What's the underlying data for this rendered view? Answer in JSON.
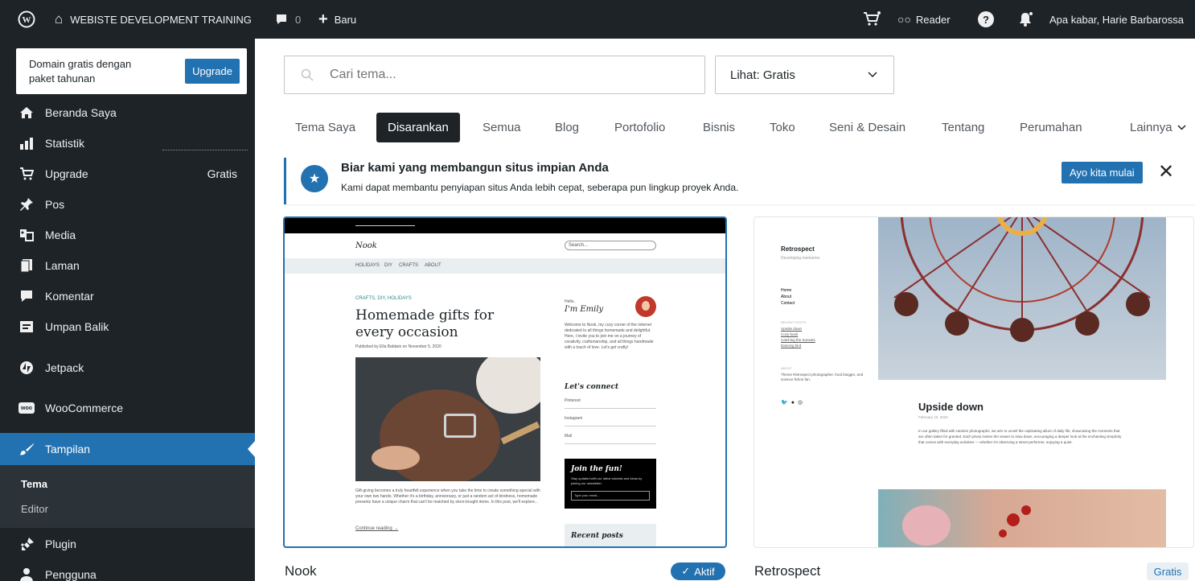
{
  "topbar": {
    "site_name": "WEBISTE DEVELOPMENT TRAINING",
    "comments_count": "0",
    "new_label": "Baru",
    "reader_label": "Reader",
    "greeting": "Apa kabar, Harie Barbarossa"
  },
  "sidebar": {
    "promo_text": "Domain gratis dengan paket tahunan",
    "promo_button": "Upgrade",
    "items": [
      {
        "label": "Beranda Saya",
        "icon": "home-icon"
      },
      {
        "label": "Statistik",
        "icon": "stats-icon"
      },
      {
        "label": "Upgrade",
        "icon": "cart-icon",
        "badge": "Gratis"
      },
      {
        "label": "Pos",
        "icon": "pin-icon"
      },
      {
        "label": "Media",
        "icon": "media-icon"
      },
      {
        "label": "Laman",
        "icon": "page-icon"
      },
      {
        "label": "Komentar",
        "icon": "comment-icon"
      },
      {
        "label": "Umpan Balik",
        "icon": "feedback-icon"
      },
      {
        "label": "Jetpack",
        "icon": "jetpack-icon"
      },
      {
        "label": "WooCommerce",
        "icon": "woo-icon"
      },
      {
        "label": "Tampilan",
        "icon": "brush-icon"
      },
      {
        "label": "Plugin",
        "icon": "plugin-icon"
      },
      {
        "label": "Pengguna",
        "icon": "user-icon"
      }
    ],
    "submenu": {
      "tema": "Tema",
      "editor": "Editor"
    }
  },
  "search": {
    "placeholder": "Cari tema..."
  },
  "filter": {
    "selected": "Lihat: Gratis"
  },
  "tabs": [
    "Tema Saya",
    "Disarankan",
    "Semua",
    "Blog",
    "Portofolio",
    "Bisnis",
    "Toko",
    "Seni & Desain",
    "Tentang",
    "Perumahan",
    "Lainnya"
  ],
  "banner": {
    "title": "Biar kami yang membangun situs impian Anda",
    "desc": "Kami dapat membantu penyiapan situs Anda lebih cepat, seberapa pun lingkup proyek Anda.",
    "button": "Ayo kita mulai"
  },
  "themes": [
    {
      "name": "Nook",
      "status": "Aktif",
      "preview": {
        "logo": "Nook",
        "nav": [
          "HOLIDAYS",
          "DIY",
          "CRAFTS",
          "ABOUT"
        ],
        "category": "CRAFTS, DIY, HOLIDAYS",
        "heading": "Homemade gifts for every occasion",
        "byline": "Published by Ella Baldwin on November 5, 2020",
        "body": "Gift-giving becomes a truly heartfelt experience when you take the time to create something special with your own two hands. Whether it's a birthday, anniversary, or just a random act of kindness, homemade presents have a unique charm that can't be matched by store-bought items. In this post, we'll explore...",
        "continue": "Continue reading →",
        "hello": "Hello,",
        "author": "I'm Emily",
        "intro": "Welcome to Nook, my cozy corner of the internet dedicated to all things homemade and delightful. Here, I invite you to join me on a journey of creativity, craftsmanship, and all things handmade with a touch of love. Let's get crafty!",
        "connect": "Let's connect",
        "links": [
          "Pinterest",
          "Instagram",
          "Mail"
        ],
        "join_title": "Join the fun!",
        "join_desc": "Stay updated with our latest tutorials and ideas by joining our newsletter.",
        "join_placeholder": "Type your email...",
        "recent": "Recent posts",
        "search_placeholder": "Search..."
      }
    },
    {
      "name": "Retrospect",
      "status": "Gratis",
      "preview": {
        "site": "Retrospect",
        "tagline": "Developing memories",
        "nav": [
          "Home",
          "About",
          "Contact"
        ],
        "recent_label": "RECENT POSTS",
        "recent": [
          "Upside down",
          "Cozy bush",
          "Catching the Sunsets",
          "Dancing bird"
        ],
        "about_label": "ABOUT",
        "about": "Theme Retrospect photographer, food blogger, and science fiction fan.",
        "post_title": "Upside down",
        "post_date": "February 10, 2020",
        "post_body": "In our gallery filled with random photographs, we aim to unveil the captivating allure of daily life, showcasing the moments that are often taken for granted. Each photo invites the viewer to slow down, encouraging a deeper look at the enchanting simplicity that comes with everyday activities — whether it's observing a street performer, enjoying a quiet."
      }
    }
  ],
  "colors": {
    "admin_bg": "#1d2327",
    "accent": "#2271b1"
  }
}
